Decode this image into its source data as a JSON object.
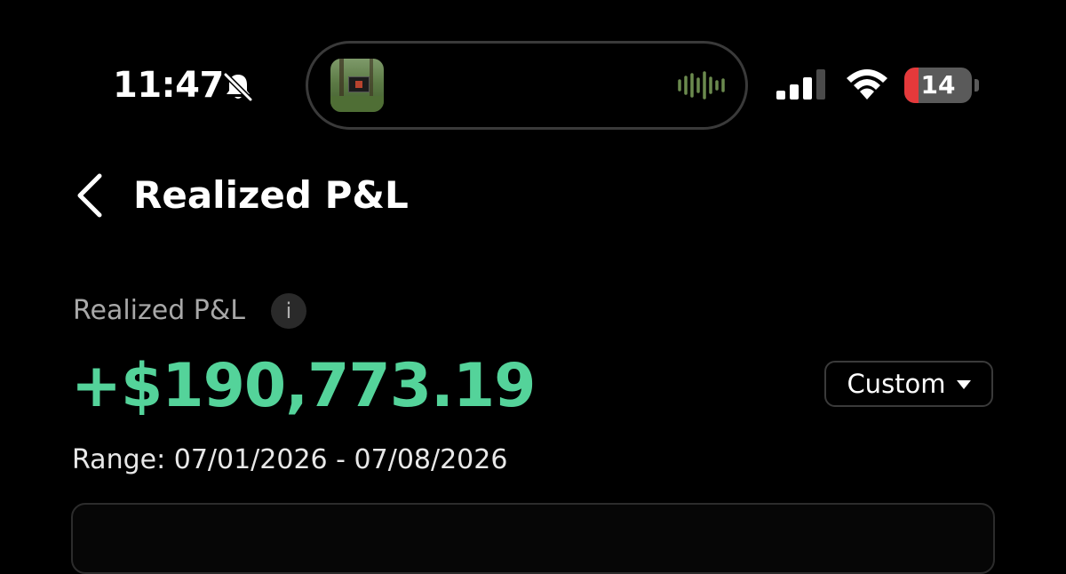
{
  "status_bar": {
    "time": "11:47",
    "battery_level": "14",
    "icons": [
      "bell-slash-icon",
      "now-playing-thumbnail",
      "audio-waveform-icon",
      "cellular-signal-icon",
      "wifi-icon",
      "battery-icon"
    ]
  },
  "header": {
    "back_icon": "chevron-left-icon",
    "title": "Realized P&L"
  },
  "summary": {
    "label": "Realized P&L",
    "info_icon": "i",
    "amount": "+$190,773.19",
    "amount_color": "#54d39a",
    "range_text": "Range: 07/01/2026 - 07/08/2026",
    "period_select": {
      "selected": "Custom"
    }
  },
  "colors": {
    "background": "#000000",
    "positive": "#54d39a",
    "battery_low": "#e5393b"
  }
}
